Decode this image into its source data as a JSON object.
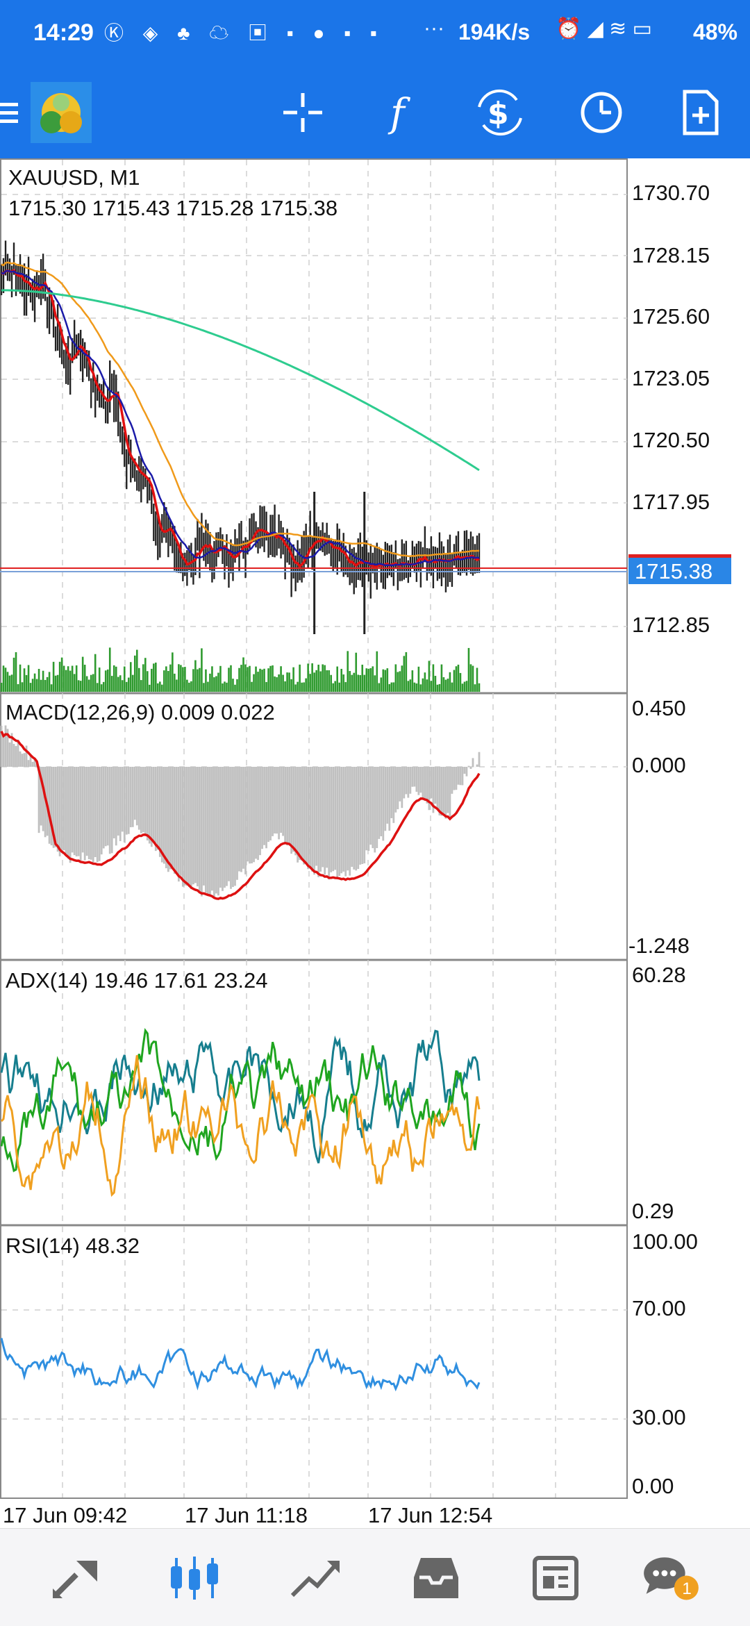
{
  "status_bar": {
    "time": "14:29",
    "network_speed": "194K/s",
    "battery": "48%"
  },
  "toolbar": {
    "icons": [
      "menu-icon",
      "app-logo-icon",
      "crosshair-icon",
      "function-icon",
      "trade-icon",
      "clock-icon",
      "new-document-icon"
    ]
  },
  "chart_header": {
    "symbol": "XAUUSD, M1",
    "ohlc": "1715.30 1715.43 1715.28 1715.38"
  },
  "price_axis": {
    "ticks": [
      "1730.70",
      "1728.15",
      "1725.60",
      "1723.05",
      "1720.50",
      "1717.95",
      "1712.85"
    ],
    "current_price": "1715.38"
  },
  "macd": {
    "label": "MACD(12,26,9) 0.009 0.022",
    "ticks": [
      "0.450",
      "0.000",
      "-1.248"
    ]
  },
  "adx": {
    "label": "ADX(14) 19.46 17.61 23.24",
    "ticks": [
      "60.28",
      "0.29"
    ]
  },
  "rsi": {
    "label": "RSI(14) 48.32",
    "ticks": [
      "100.00",
      "70.00",
      "30.00",
      "0.00"
    ]
  },
  "time_axis": {
    "labels": [
      "17 Jun 09:42",
      "17 Jun 11:18",
      "17 Jun 12:54"
    ]
  },
  "bottom_nav": {
    "items": [
      "quotes-icon",
      "chart-icon",
      "trade-icon",
      "history-icon",
      "news-icon",
      "messages-icon"
    ],
    "messages_badge": "1"
  },
  "colors": {
    "accent": "#1b75e8",
    "candles": "#222222",
    "volume": "#2e9a2e",
    "ma_fast": "#e01010",
    "ma_mid": "#1a1aa8",
    "ma_slow": "#f09a1a",
    "ma_long": "#2ecc8f",
    "macd_hist": "#c0c0c0",
    "macd_signal": "#dd1111",
    "adx_main": "#167e8e",
    "adx_plus": "#1fa51f",
    "adx_minus": "#f0a020",
    "rsi": "#2f8fe0"
  }
}
